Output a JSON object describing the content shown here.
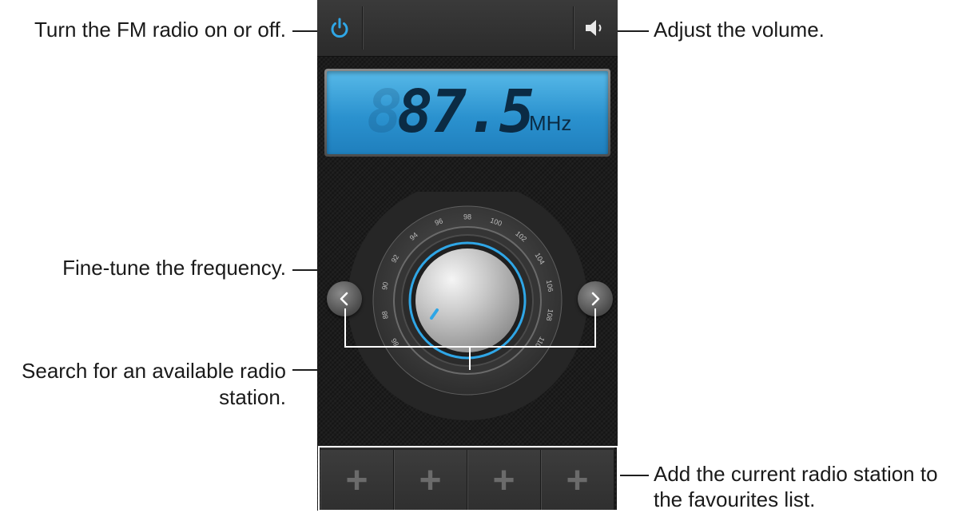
{
  "callouts": {
    "power": "Turn the FM radio on or off.",
    "volume": "Adjust the volume.",
    "fine_tune": "Fine-tune the frequency.",
    "search_line1": "Search for an available radio",
    "search_line2": "station.",
    "favourite_line1": "Add the current radio station to",
    "favourite_line2": "the favourites list."
  },
  "radio": {
    "frequency": "87.5",
    "unit": "MHz",
    "ghost_digits": "8",
    "dial_ticks": [
      "86",
      "88",
      "90",
      "92",
      "94",
      "96",
      "98",
      "100",
      "102",
      "104",
      "106",
      "108",
      "110"
    ]
  },
  "icons": {
    "power": "power-icon",
    "volume": "volume-icon",
    "prev": "chevron-left-icon",
    "next": "chevron-right-icon",
    "add": "plus-icon"
  },
  "favourites": {
    "slot_label": "+"
  },
  "colors": {
    "accent_blue": "#2fa6e6",
    "lcd_blue": "#3aa5dd",
    "callout_text": "#1a1a1a"
  }
}
